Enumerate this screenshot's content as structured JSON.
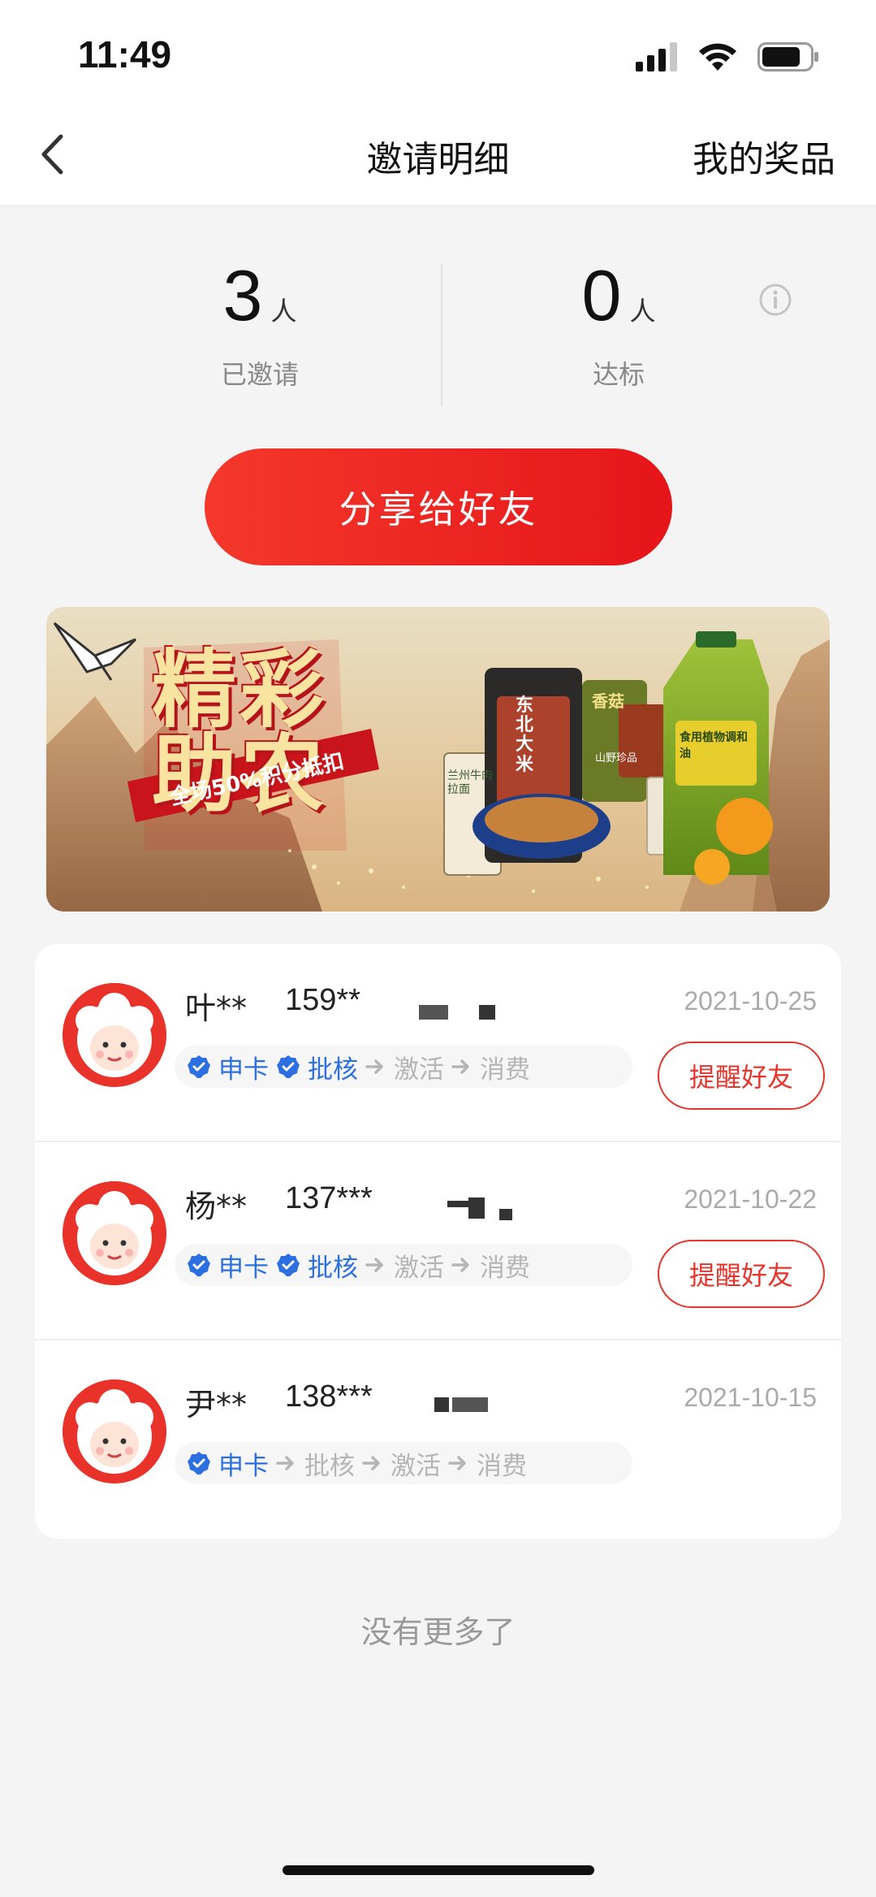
{
  "status": {
    "time": "11:49"
  },
  "nav": {
    "title": "邀请明细",
    "right": "我的奖品"
  },
  "stats": {
    "invited": {
      "value": "3",
      "unit": "人",
      "label": "已邀请"
    },
    "qualified": {
      "value": "0",
      "unit": "人",
      "label": "达标"
    }
  },
  "share_button": "分享给好友",
  "banner": {
    "headline_line1": "精彩",
    "headline_line2": "助农",
    "ribbon": "全场50%积分抵扣",
    "product_labels": [
      "东北大米",
      "兰州牛肉拉面",
      "香菇",
      "山野珍品",
      "食用植物调和油"
    ]
  },
  "steps": [
    "申卡",
    "批核",
    "激活",
    "消费"
  ],
  "invites": [
    {
      "name": "叶**",
      "phone": "159**",
      "date": "2021-10-25",
      "completed_steps": 2,
      "remind": "提醒好友"
    },
    {
      "name": "杨**",
      "phone": "137***",
      "date": "2021-10-22",
      "completed_steps": 2,
      "remind": "提醒好友"
    },
    {
      "name": "尹**",
      "phone": "138***",
      "date": "2021-10-15",
      "completed_steps": 1
    }
  ],
  "footer": {
    "no_more": "没有更多了"
  },
  "colors": {
    "accent": "#e5352c",
    "step_done": "#2c6fe0",
    "step_todo": "#b5b5b5"
  }
}
